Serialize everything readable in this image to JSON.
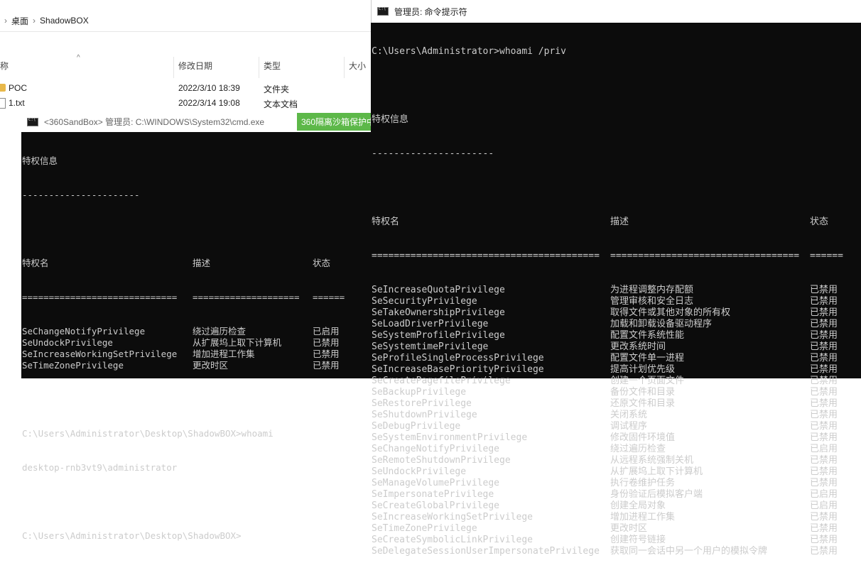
{
  "explorer": {
    "breadcrumb": [
      "桌面",
      "ShadowBOX"
    ],
    "columns": {
      "name": "称",
      "date": "修改日期",
      "type": "类型",
      "size": "大小"
    },
    "files": [
      {
        "name": "POC",
        "date": "2022/3/10 18:39",
        "type": "文件夹",
        "icon": "folder-icon"
      },
      {
        "name": "1.txt",
        "date": "2022/3/14 19:08",
        "type": "文本文档",
        "icon": "text-file-icon"
      }
    ]
  },
  "sandbox_cmd": {
    "title": "<360SandBox> 管理员: C:\\WINDOWS\\System32\\cmd.exe",
    "tag": "360隔离沙箱保护中",
    "heading": "特权信息",
    "heading_rule": "----------------------",
    "col_name": "特权名",
    "col_desc": "描述",
    "col_state": "状态",
    "rule_name": "=============================",
    "rule_desc": "====================",
    "rule_state": "======",
    "rows": [
      {
        "name": "SeChangeNotifyPrivilege",
        "desc": "绕过遍历检查",
        "state": "已启用"
      },
      {
        "name": "SeUndockPrivilege",
        "desc": "从扩展坞上取下计算机",
        "state": "已禁用"
      },
      {
        "name": "SeIncreaseWorkingSetPrivilege",
        "desc": "增加进程工作集",
        "state": "已禁用"
      },
      {
        "name": "SeTimeZonePrivilege",
        "desc": "更改时区",
        "state": "已禁用"
      }
    ],
    "cmd1": "C:\\Users\\Administrator\\Desktop\\ShadowBOX>whoami",
    "out1": "desktop-rnb3vt9\\administrator",
    "prompt": "C:\\Users\\Administrator\\Desktop\\ShadowBOX>"
  },
  "admin_cmd": {
    "title": "管理员: 命令提示符",
    "cmd": "C:\\Users\\Administrator>whoami /priv",
    "heading": "特权信息",
    "heading_rule": "----------------------",
    "col_name": "特权名",
    "col_desc": "描述",
    "col_state": "状态",
    "rule_name": "=========================================",
    "rule_desc": "==================================",
    "rule_state": "======",
    "rows": [
      {
        "name": "SeIncreaseQuotaPrivilege",
        "desc": "为进程调整内存配额",
        "state": "已禁用"
      },
      {
        "name": "SeSecurityPrivilege",
        "desc": "管理审核和安全日志",
        "state": "已禁用"
      },
      {
        "name": "SeTakeOwnershipPrivilege",
        "desc": "取得文件或其他对象的所有权",
        "state": "已禁用"
      },
      {
        "name": "SeLoadDriverPrivilege",
        "desc": "加载和卸载设备驱动程序",
        "state": "已禁用"
      },
      {
        "name": "SeSystemProfilePrivilege",
        "desc": "配置文件系统性能",
        "state": "已禁用"
      },
      {
        "name": "SeSystemtimePrivilege",
        "desc": "更改系统时间",
        "state": "已禁用"
      },
      {
        "name": "SeProfileSingleProcessPrivilege",
        "desc": "配置文件单一进程",
        "state": "已禁用"
      },
      {
        "name": "SeIncreaseBasePriorityPrivilege",
        "desc": "提高计划优先级",
        "state": "已禁用"
      },
      {
        "name": "SeCreatePagefilePrivilege",
        "desc": "创建一个页面文件",
        "state": "已禁用"
      },
      {
        "name": "SeBackupPrivilege",
        "desc": "备份文件和目录",
        "state": "已禁用"
      },
      {
        "name": "SeRestorePrivilege",
        "desc": "还原文件和目录",
        "state": "已禁用"
      },
      {
        "name": "SeShutdownPrivilege",
        "desc": "关闭系统",
        "state": "已禁用"
      },
      {
        "name": "SeDebugPrivilege",
        "desc": "调试程序",
        "state": "已禁用"
      },
      {
        "name": "SeSystemEnvironmentPrivilege",
        "desc": "修改固件环境值",
        "state": "已禁用"
      },
      {
        "name": "SeChangeNotifyPrivilege",
        "desc": "绕过遍历检查",
        "state": "已启用"
      },
      {
        "name": "SeRemoteShutdownPrivilege",
        "desc": "从远程系统强制关机",
        "state": "已禁用"
      },
      {
        "name": "SeUndockPrivilege",
        "desc": "从扩展坞上取下计算机",
        "state": "已禁用"
      },
      {
        "name": "SeManageVolumePrivilege",
        "desc": "执行卷维护任务",
        "state": "已禁用"
      },
      {
        "name": "SeImpersonatePrivilege",
        "desc": "身份验证后模拟客户端",
        "state": "已启用"
      },
      {
        "name": "SeCreateGlobalPrivilege",
        "desc": "创建全局对象",
        "state": "已启用"
      },
      {
        "name": "SeIncreaseWorkingSetPrivilege",
        "desc": "增加进程工作集",
        "state": "已禁用"
      },
      {
        "name": "SeTimeZonePrivilege",
        "desc": "更改时区",
        "state": "已禁用"
      },
      {
        "name": "SeCreateSymbolicLinkPrivilege",
        "desc": "创建符号链接",
        "state": "已禁用"
      },
      {
        "name": "SeDelegateSessionUserImpersonatePrivilege",
        "desc": "获取同一会话中另一个用户的模拟令牌",
        "state": "已禁用"
      }
    ]
  }
}
